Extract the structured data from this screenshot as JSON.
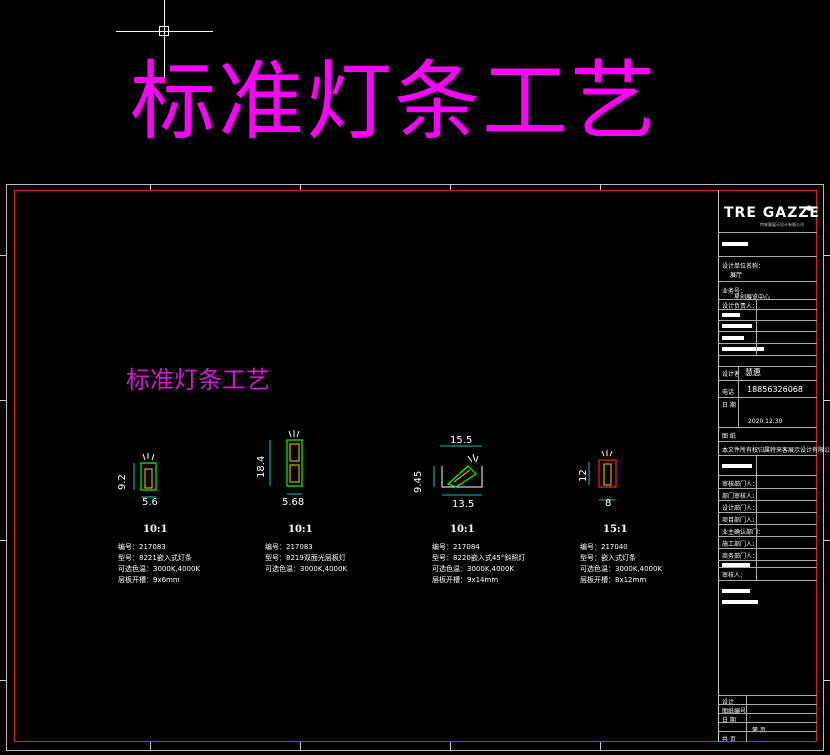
{
  "title_large": "标准灯条工艺",
  "title_small": "标准灯条工艺",
  "logo": {
    "text": "TRE GAZZE",
    "tagline": "特来客展示设计有限公司"
  },
  "details": [
    {
      "scale": "10:1",
      "dim_w": "5.6",
      "dim_h": "9.2",
      "dim_top": "",
      "spec": [
        "编号：217083",
        "型号：8221嵌入式灯条",
        "可选色温：3000K,4000K",
        "层板开槽：9x6mm"
      ]
    },
    {
      "scale": "10:1",
      "dim_w": "5.68",
      "dim_h": "18.4",
      "dim_top": "",
      "spec": [
        "编号：217083",
        "型号：8219双面光层板灯",
        "可选色温：3000K,4000K"
      ]
    },
    {
      "scale": "10:1",
      "dim_w": "13.5",
      "dim_h": "9.45",
      "dim_top": "15.5",
      "spec": [
        "编号：217084",
        "型号：8220嵌入式45°斜照灯",
        "可选色温：3000K,4000K",
        "层板开槽：9x14mm"
      ]
    },
    {
      "scale": "15:1",
      "dim_w": "8",
      "dim_h": "12",
      "dim_top": "",
      "spec": [
        "编号：217040",
        "型号：嵌入式灯条",
        "可选色温：3000K,4000K",
        "层板开槽：8x12mm"
      ]
    }
  ],
  "titleblock": {
    "project_label": "设计单位名称：",
    "project_value": "展厅",
    "project2_label": "业务号：",
    "project2_value": "星创展览中心",
    "designer_label": "设计负责人：",
    "sign_label": "设计者",
    "sign_value": "慧惠",
    "phone_label": "电话",
    "phone_value": "18856326068",
    "date_label": "日 期",
    "date_value": "2020.12.30",
    "remark_label": "图 纸",
    "remark_value": "本文件所有权归属特来客展示设计有限公司",
    "rows": [
      "审核部门人：",
      "部门审核人：",
      "设计部门人：",
      "项目部门人：",
      "业主确认部门：",
      "施工部门人：",
      "商务部门人：",
      "审核人："
    ],
    "bottom_rows": [
      "设计",
      "图纸编号",
      "日 期",
      "第  页",
      "共  页"
    ]
  },
  "colors": {
    "magenta": "#ff00ff",
    "frame_red": "#e02020",
    "lamp_green": "#00ff00",
    "lamp_red": "#ff2020",
    "dim_cyan": "#00ffff"
  }
}
